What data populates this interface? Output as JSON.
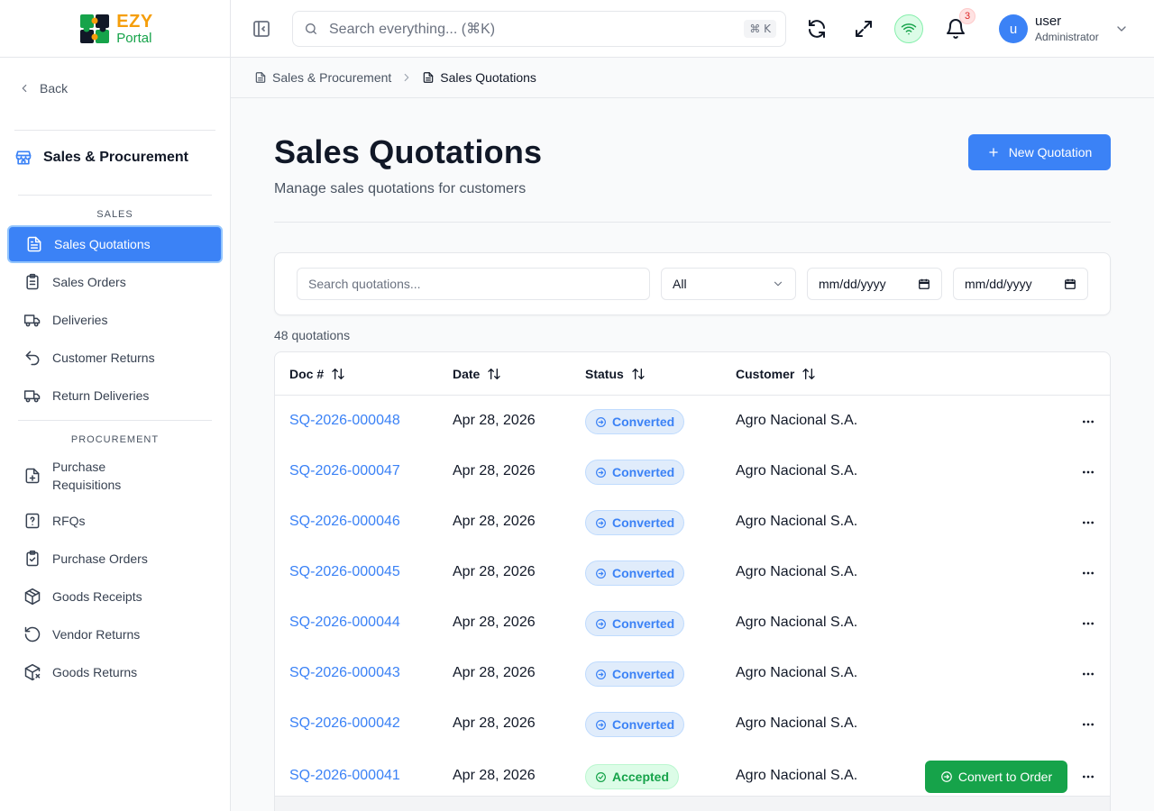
{
  "app": {
    "logo_top": "EZY",
    "logo_bottom": "Portal"
  },
  "sidebar": {
    "back_label": "Back",
    "module_title": "Sales & Procurement",
    "sales_label": "SALES",
    "procurement_label": "PROCUREMENT",
    "sales_items": [
      {
        "label": "Sales Quotations",
        "icon": "file-text-icon",
        "active": true
      },
      {
        "label": "Sales Orders",
        "icon": "clipboard-list-icon"
      },
      {
        "label": "Deliveries",
        "icon": "truck-icon"
      },
      {
        "label": "Customer Returns",
        "icon": "undo-icon"
      },
      {
        "label": "Return Deliveries",
        "icon": "truck-icon"
      }
    ],
    "procurement_items": [
      {
        "label": "Purchase\nRequisitions",
        "icon": "file-plus-icon"
      },
      {
        "label": "RFQs",
        "icon": "file-question-icon"
      },
      {
        "label": "Purchase Orders",
        "icon": "clipboard-check-icon"
      },
      {
        "label": "Goods Receipts",
        "icon": "package-icon"
      },
      {
        "label": "Vendor Returns",
        "icon": "rotate-ccw-icon"
      },
      {
        "label": "Goods Returns",
        "icon": "package-x-icon"
      }
    ]
  },
  "header": {
    "search_placeholder": "Search everything... (⌘K)",
    "search_shortcut": "⌘ K",
    "notification_count": "3",
    "user": {
      "avatar": "u",
      "name": "user",
      "role": "Administrator"
    }
  },
  "breadcrumb": {
    "parent": "Sales & Procurement",
    "current": "Sales Quotations"
  },
  "main": {
    "title": "Sales Quotations",
    "subtitle": "Manage sales quotations for customers",
    "new_button": "New Quotation",
    "filters": {
      "search_placeholder": "Search quotations...",
      "status_value": "All",
      "date_from": "mm/dd/yyyy",
      "date_to": "mm/dd/yyyy"
    },
    "count_text": "48 quotations",
    "columns": [
      "Doc #",
      "Date",
      "Status",
      "Customer"
    ],
    "rows": [
      {
        "doc": "SQ-2026-000048",
        "date": "Apr 28, 2026",
        "status": "Converted",
        "customer": "Agro Nacional S.A."
      },
      {
        "doc": "SQ-2026-000047",
        "date": "Apr 28, 2026",
        "status": "Converted",
        "customer": "Agro Nacional S.A."
      },
      {
        "doc": "SQ-2026-000046",
        "date": "Apr 28, 2026",
        "status": "Converted",
        "customer": "Agro Nacional S.A."
      },
      {
        "doc": "SQ-2026-000045",
        "date": "Apr 28, 2026",
        "status": "Converted",
        "customer": "Agro Nacional S.A."
      },
      {
        "doc": "SQ-2026-000044",
        "date": "Apr 28, 2026",
        "status": "Converted",
        "customer": "Agro Nacional S.A."
      },
      {
        "doc": "SQ-2026-000043",
        "date": "Apr 28, 2026",
        "status": "Converted",
        "customer": "Agro Nacional S.A."
      },
      {
        "doc": "SQ-2026-000042",
        "date": "Apr 28, 2026",
        "status": "Converted",
        "customer": "Agro Nacional S.A."
      },
      {
        "doc": "SQ-2026-000041",
        "date": "Apr 28, 2026",
        "status": "Accepted",
        "customer": "Agro Nacional S.A.",
        "action": "Convert to Order"
      }
    ]
  },
  "colors": {
    "primary": "#3b82f6",
    "success": "#16a34a",
    "brand_orange": "#f59e0b"
  }
}
